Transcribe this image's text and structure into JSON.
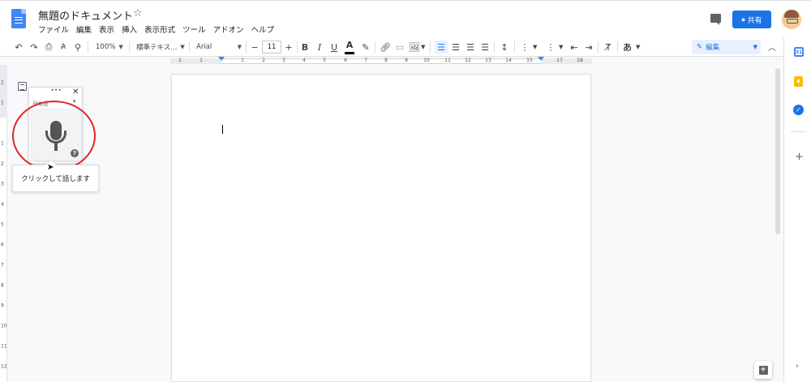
{
  "header": {
    "title": "無題のドキュメント",
    "star": "☆",
    "menu": [
      "ファイル",
      "編集",
      "表示",
      "挿入",
      "表示形式",
      "ツール",
      "アドオン",
      "ヘルプ"
    ],
    "share_label": "共有",
    "share_icon": "lock-icon",
    "accent_color": "#1a73e8"
  },
  "toolbar": {
    "zoom": "100%",
    "style": "標準テキス...",
    "font": "Arial",
    "font_size": "11",
    "minus": "−",
    "plus": "+",
    "bold": "B",
    "italic": "I",
    "underline": "U",
    "text_color": "A",
    "input_tools": "あ",
    "edit_mode": "編集"
  },
  "ruler": {
    "ticks": [
      "2",
      "1",
      "1",
      "2",
      "3",
      "4",
      "5",
      "6",
      "7",
      "8",
      "9",
      "10",
      "11",
      "12",
      "13",
      "14",
      "15",
      "16",
      "17",
      "18"
    ],
    "vticks": [
      "2",
      "1",
      "1",
      "2",
      "3",
      "4",
      "5",
      "6",
      "7",
      "8",
      "9",
      "10",
      "11",
      "12"
    ]
  },
  "voice_typing": {
    "more": "···",
    "close": "✕",
    "language": "日本語",
    "help": "?",
    "tooltip": "クリックして話します",
    "highlight_color": "#e0242a"
  },
  "side_panel": {
    "calendar": "31",
    "tasks": "✓",
    "add": "+",
    "expand": "›"
  }
}
